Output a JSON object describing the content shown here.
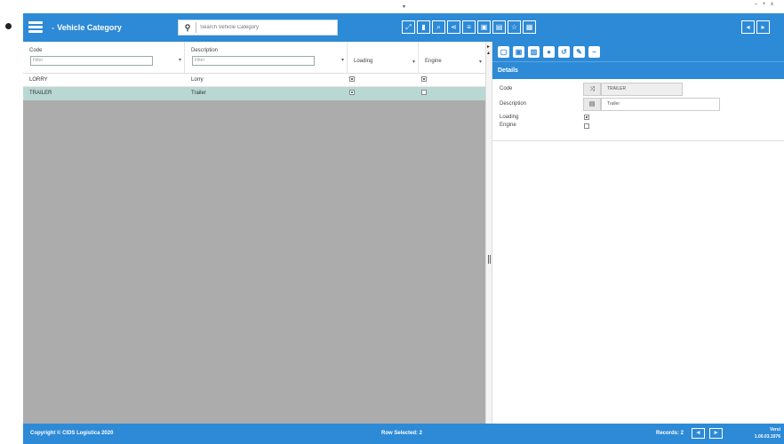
{
  "window": {
    "controls": "– + x",
    "top_marker": "▾"
  },
  "header": {
    "title_prefix": "≈",
    "title": "Vehicle Category",
    "search": {
      "icon": "search-icon",
      "placeholder": "Search Vehicle Category",
      "value": ""
    },
    "toolbar_icons": [
      {
        "name": "expand-icon",
        "glyph": "⤢"
      },
      {
        "name": "bookmark-icon",
        "glyph": "▮"
      },
      {
        "name": "filter-icon",
        "glyph": "⌕"
      },
      {
        "name": "share-icon",
        "glyph": "⋖"
      },
      {
        "name": "list-icon",
        "glyph": "≡"
      },
      {
        "name": "save-icon",
        "glyph": "▣"
      },
      {
        "name": "export-icon",
        "glyph": "▤"
      },
      {
        "name": "star-icon",
        "glyph": "☆"
      },
      {
        "name": "grid-icon",
        "glyph": "▦"
      }
    ],
    "right_icons": [
      {
        "name": "back-icon",
        "glyph": "◂"
      },
      {
        "name": "logout-icon",
        "glyph": "▸"
      }
    ]
  },
  "grid": {
    "columns": [
      {
        "label": "Code",
        "filter_placeholder": "Filter"
      },
      {
        "label": "Description",
        "filter_placeholder": "Filter"
      },
      {
        "label": "Loading"
      },
      {
        "label": "Engine"
      }
    ],
    "rows": [
      {
        "code": "LORRY",
        "description": "Lorry",
        "loading": true,
        "engine": true,
        "selected": false
      },
      {
        "code": "TRAILER",
        "description": "Trailer",
        "loading": true,
        "engine": false,
        "selected": true
      }
    ]
  },
  "detail": {
    "toolbar_icons": [
      "new-icon",
      "save-icon",
      "delete-icon",
      "info-icon",
      "undo-icon",
      "edit-icon",
      "minus-icon"
    ],
    "title": "Details",
    "fields": {
      "code": {
        "label": "Code",
        "value": "TRAILER"
      },
      "description": {
        "label": "Description",
        "value": "Trailer"
      },
      "loading": {
        "label": "Loading",
        "checked": true
      },
      "engine": {
        "label": "Engine",
        "checked": false
      }
    }
  },
  "footer": {
    "copyright": "Copyright © CIDS Logistica 2020",
    "row_selected": "Row Selected: 2",
    "records": "Records: 2",
    "version_label": "Versi",
    "version_value": "1.00.03.1976"
  }
}
